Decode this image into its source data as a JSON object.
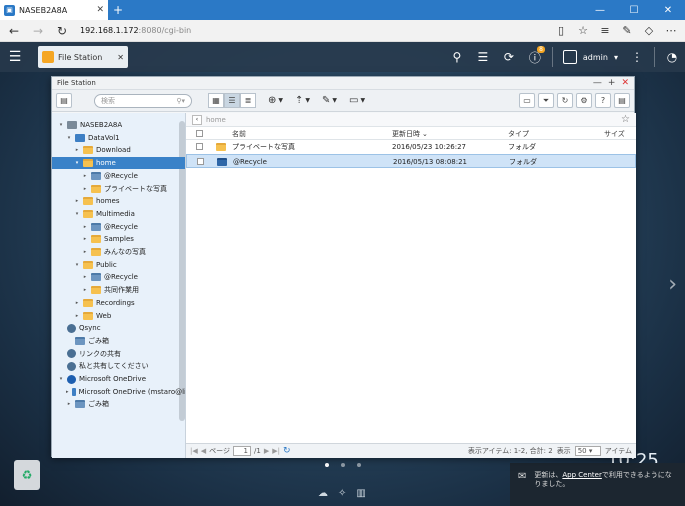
{
  "browser": {
    "tab_title": "NASEB2A8A",
    "url_host": "192.168.1.172",
    "url_path": ":8080/cgi-bin"
  },
  "topbar": {
    "app_tab_label": "File Station",
    "notification_count": "8",
    "user": "admin"
  },
  "window": {
    "title": "File Station",
    "search_placeholder": "検索",
    "breadcrumb": "home"
  },
  "tree": [
    {
      "label": "NASEB2A8A",
      "icon": "nas"
    },
    {
      "label": "DataVol1",
      "icon": "disk"
    },
    {
      "label": "Download",
      "icon": "folder"
    },
    {
      "label": "home",
      "icon": "folder",
      "selected": true
    },
    {
      "label": "@Recycle",
      "icon": "recycle"
    },
    {
      "label": "プライベートな写真",
      "icon": "folder"
    },
    {
      "label": "homes",
      "icon": "folder"
    },
    {
      "label": "Multimedia",
      "icon": "folder"
    },
    {
      "label": "@Recycle",
      "icon": "recycle"
    },
    {
      "label": "Samples",
      "icon": "folder"
    },
    {
      "label": "みんなの写真",
      "icon": "folder"
    },
    {
      "label": "Public",
      "icon": "folder"
    },
    {
      "label": "@Recycle",
      "icon": "recycle"
    },
    {
      "label": "共同作業用",
      "icon": "folder"
    },
    {
      "label": "Recordings",
      "icon": "folder"
    },
    {
      "label": "Web",
      "icon": "folder"
    },
    {
      "label": "Qsync",
      "icon": "circle"
    },
    {
      "label": "ごみ箱",
      "icon": "recycle"
    },
    {
      "label": "リンクの共有",
      "icon": "share"
    },
    {
      "label": "私と共有してください",
      "icon": "person"
    },
    {
      "label": "Microsoft OneDrive",
      "icon": "onedrive"
    },
    {
      "label": "Microsoft OneDrive (mstaro@li",
      "icon": "disk"
    },
    {
      "label": "ごみ箱",
      "icon": "recycle"
    }
  ],
  "table": {
    "headers": {
      "name": "名前",
      "modified": "更新日時",
      "type": "タイプ",
      "size": "サイズ"
    },
    "rows": [
      {
        "name": "プライベートな写真",
        "modified": "2016/05/23 10:26:27",
        "type": "フォルダ",
        "icon": "folder"
      },
      {
        "name": "@Recycle",
        "modified": "2016/05/13 08:08:21",
        "type": "フォルダ",
        "icon": "recycle",
        "selected": true
      }
    ]
  },
  "status": {
    "page_label": "ページ",
    "page_value": "1",
    "page_total": "/1",
    "items_text": "表示アイテム: 1-2, 合計: 2",
    "show_label": "表示",
    "per_page": "50",
    "items_label": "アイテム"
  },
  "desktop": {
    "clock": "10:25"
  },
  "notification": {
    "prefix": "更新は、",
    "link": "App Center",
    "suffix": "で利用できるようになりました。"
  },
  "colors": {
    "accent": "#2b79c6",
    "folder": "#f6c14f",
    "selected_row": "#cfe3f7"
  }
}
